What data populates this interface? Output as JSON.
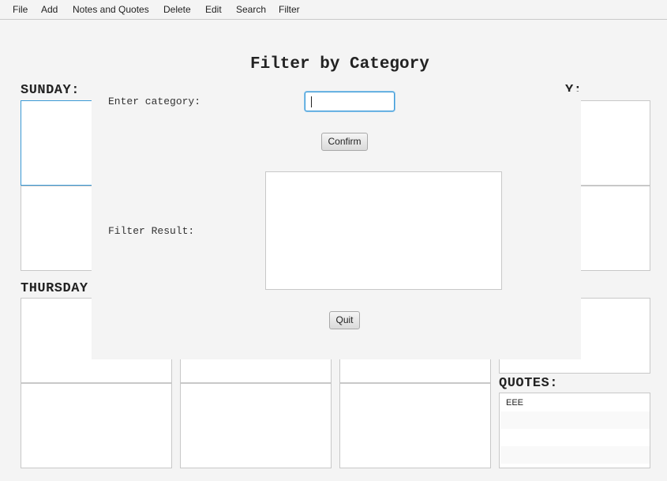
{
  "menu": {
    "file": "File",
    "add": "Add",
    "notes_quotes": "Notes and Quotes",
    "delete": "Delete",
    "edit": "Edit",
    "search": "Search",
    "filter": "Filter"
  },
  "days": {
    "sunday": "SUNDAY:",
    "saturday_partial": "Y:",
    "thursday": "THURSDAY"
  },
  "quotes": {
    "label": "QUOTES:",
    "items": [
      "EEE"
    ]
  },
  "dialog": {
    "title": "Filter by Category",
    "category_label": "Enter category:",
    "category_value": "",
    "confirm_label": "Confirm",
    "result_label": "Filter Result:",
    "result_value": "",
    "quit_label": "Quit"
  },
  "colors": {
    "focus_border": "#3b9ad6",
    "background": "#f4f4f4"
  }
}
